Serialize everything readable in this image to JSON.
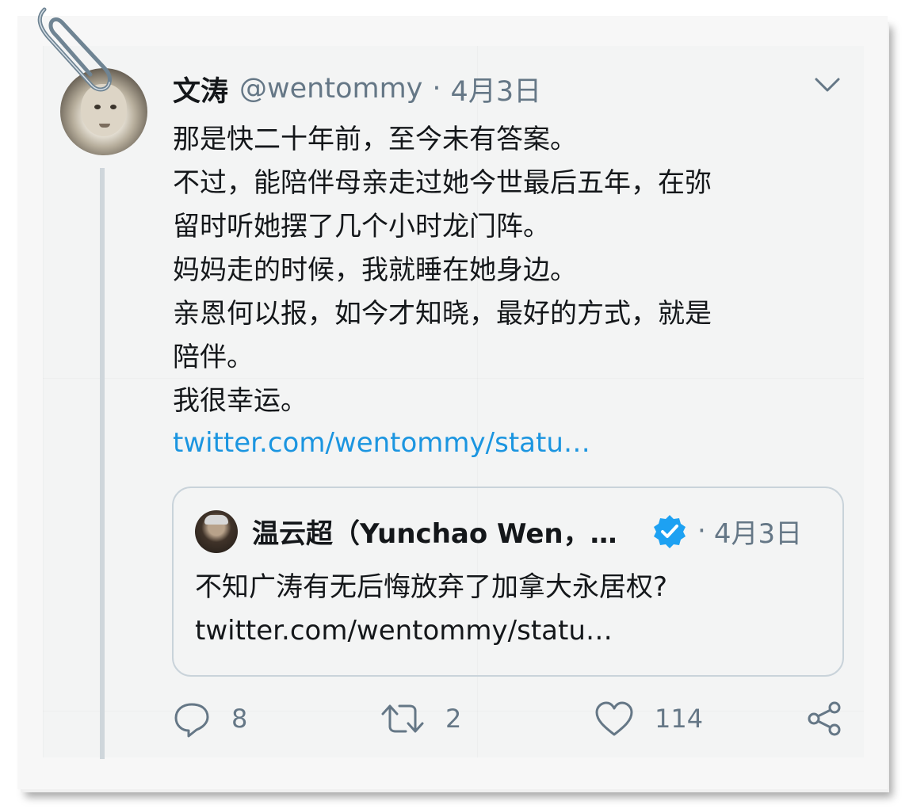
{
  "tweet": {
    "author_name": "文涛",
    "handle": "@wentommy",
    "separator": "·",
    "date": "4月3日",
    "text_lines": [
      "那是快二十年前，至今未有答案。",
      "不过，能陪伴母亲走过她今世最后五年，在弥",
      "留时听她摆了几个小时龙门阵。",
      "妈妈走的时候，我就睡在她身边。",
      "亲恩何以报，如今才知晓，最好的方式，就是",
      "陪伴。",
      "我很幸运。"
    ],
    "link": "twitter.com/wentommy/statu…"
  },
  "quote": {
    "author_name": "温云超（Yunchao Wen，…",
    "separator": "·",
    "date": "4月3日",
    "text_lines": [
      "不知广涛有无后悔放弃了加拿大永居权?",
      "twitter.com/wentommy/statu…"
    ]
  },
  "actions": {
    "replies": "8",
    "retweets": "2",
    "likes": "114"
  },
  "colors": {
    "accent": "#1b95e0",
    "text": "#14171a",
    "muted": "#657786",
    "verified": "#1da1f2"
  },
  "icons": [
    "paperclip-icon",
    "chevron-down-icon",
    "verified-badge-icon",
    "reply-icon",
    "retweet-icon",
    "like-icon",
    "share-icon"
  ]
}
